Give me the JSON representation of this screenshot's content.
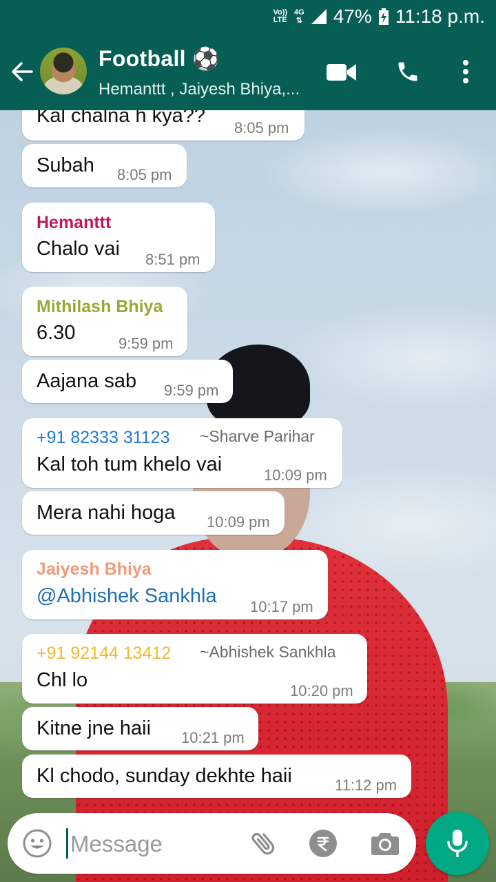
{
  "status_bar": {
    "volte": "Vo)) LTE",
    "volte_line1": "Vo))",
    "volte_line2": "LTE",
    "network": "4G",
    "battery_percent": "47%",
    "time": "11:18 p.m."
  },
  "header": {
    "title": "Football ⚽",
    "members": "Hemanttt , Jaiyesh Bhiya,..."
  },
  "messages": [
    {
      "text": "Kal chalna h kya??",
      "time": "8:05 pm"
    },
    {
      "text": "Subah",
      "time": "8:05 pm"
    },
    {
      "sender": "Hemanttt",
      "sender_color": "#c2185b",
      "text": "Chalo vai",
      "time": "8:51 pm"
    },
    {
      "sender": "Mithilash Bhiya",
      "sender_color": "#9aa637",
      "text": "6.30",
      "time": "9:59 pm"
    },
    {
      "text": "Aajana sab",
      "time": "9:59 pm"
    },
    {
      "sender": "+91 82333 31123",
      "sender_color": "#1e7ad6",
      "push_name": "~Sharve Parihar",
      "text": "Kal toh tum khelo vai",
      "time": "10:09 pm"
    },
    {
      "text": "Mera nahi hoga",
      "time": "10:09 pm"
    },
    {
      "sender": "Jaiyesh Bhiya",
      "sender_color": "#f09a78",
      "text": "@Abhishek Sankhla",
      "mention": true,
      "time": "10:17 pm"
    },
    {
      "sender": "+91 92144 13412",
      "sender_color": "#f1b92f",
      "push_name": "~Abhishek Sankhla",
      "text": "Chl lo",
      "time": "10:20 pm"
    },
    {
      "text": "Kitne jne haii",
      "time": "10:21 pm"
    },
    {
      "text": "Kl chodo, sunday dekhte haii",
      "time": "11:12 pm"
    }
  ],
  "composer": {
    "placeholder": "Message"
  },
  "colors": {
    "header_bg": "#075e54",
    "mic_bg": "#00a884",
    "bubble_bg": "#ffffff"
  },
  "icons": [
    "back-arrow-icon",
    "video-call-icon",
    "phone-icon",
    "more-vert-icon",
    "emoji-icon",
    "attach-icon",
    "rupee-icon",
    "camera-icon",
    "mic-icon"
  ]
}
